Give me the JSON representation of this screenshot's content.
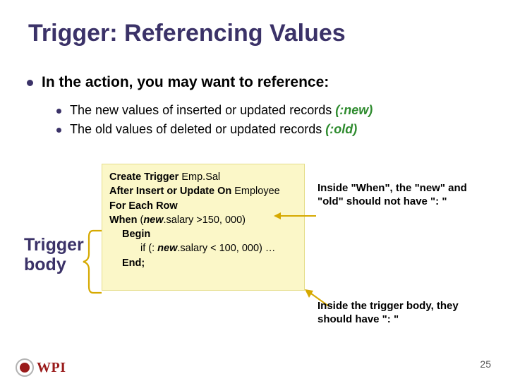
{
  "title": "Trigger: Referencing Values",
  "main_bullet": "In the action, you may want to reference:",
  "sub_bullets": [
    {
      "text": "The new values of inserted or updated records ",
      "em": "(:new)"
    },
    {
      "text": "The old values of deleted or updated records   ",
      "em": "(:old)"
    }
  ],
  "code": {
    "l1_kw": "Create Trigger",
    "l1_rest": " Emp.Sal",
    "l2_kw": "After Insert or Update On",
    "l2_rest": " Employee",
    "l3_kw": "For Each Row",
    "l4_kw": "When",
    "l4_open": " (",
    "l4_em": "new",
    "l4_rest": ".salary >150, 000)",
    "l5_kw": "Begin",
    "l6a": "if (: ",
    "l6_em": "new",
    "l6b": ".salary < 100, 000) …",
    "l7_kw": "End;"
  },
  "side_label_1": "Trigger",
  "side_label_2": "body",
  "note1": "Inside \"When\", the \"new\" and \"old\" should not have \": \"",
  "note2": "Inside the trigger body, they should have \": \"",
  "page_number": "25",
  "logo_text": "WPI"
}
